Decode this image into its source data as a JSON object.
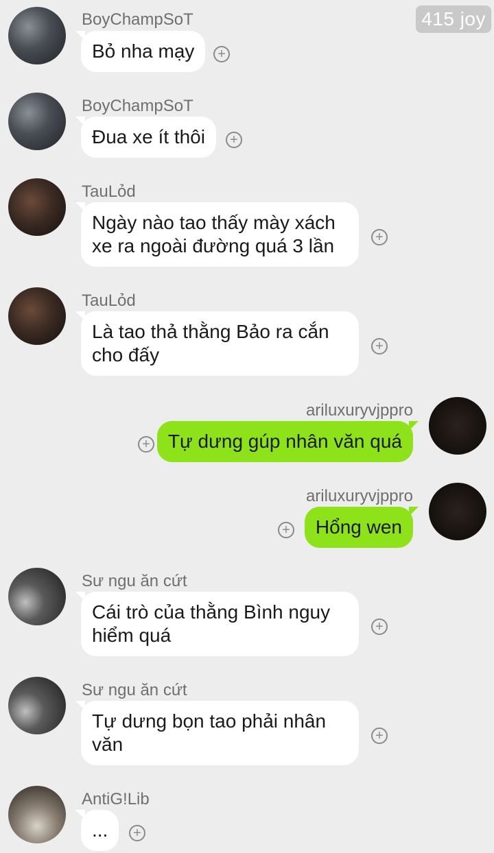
{
  "top_badge": "415 joy",
  "messages": [
    {
      "sender": "BoyChampSoT",
      "text": "Bỏ nha mạy",
      "avatar": "boychampsot-avatar",
      "side": "in"
    },
    {
      "sender": "BoyChampSoT",
      "text": "Đua xe ít thôi",
      "avatar": "boychampsot-avatar",
      "side": "in"
    },
    {
      "sender": "TauLỏd",
      "text": "Ngày nào tao thấy mày xách xe ra ngoài đường quá 3 lần",
      "avatar": "taulod-avatar",
      "side": "in"
    },
    {
      "sender": "TauLỏd",
      "text": "Là tao thả thằng Bảo ra cắn cho đấy",
      "avatar": "taulod-avatar",
      "side": "in"
    },
    {
      "sender": "ariluxuryvjppro",
      "text": "Tự dưng gúp nhân văn quá",
      "avatar": "ariluxuryvjppro-avatar",
      "side": "out"
    },
    {
      "sender": "ariluxuryvjppro",
      "text": "Hổng wen",
      "avatar": "ariluxuryvjppro-avatar",
      "side": "out"
    },
    {
      "sender": "Sư ngu ăn cứt",
      "text": "Cái trò của thằng Bình nguy hiểm quá",
      "avatar": "su-ngu-an-cut-avatar",
      "side": "in"
    },
    {
      "sender": "Sư ngu ăn cứt",
      "text": "Tự dưng bọn tao phải nhân văn",
      "avatar": "su-ngu-an-cut-avatar",
      "side": "in"
    },
    {
      "sender": "AntiG!Lib",
      "text": "...",
      "avatar": "antiglib-avatar",
      "side": "in"
    }
  ],
  "add_reaction_icon": "plus-circle-icon",
  "colors": {
    "background": "#ededed",
    "incoming_bubble": "#ffffff",
    "outgoing_bubble": "#8ee21a",
    "name_text": "#6f6f6f"
  }
}
